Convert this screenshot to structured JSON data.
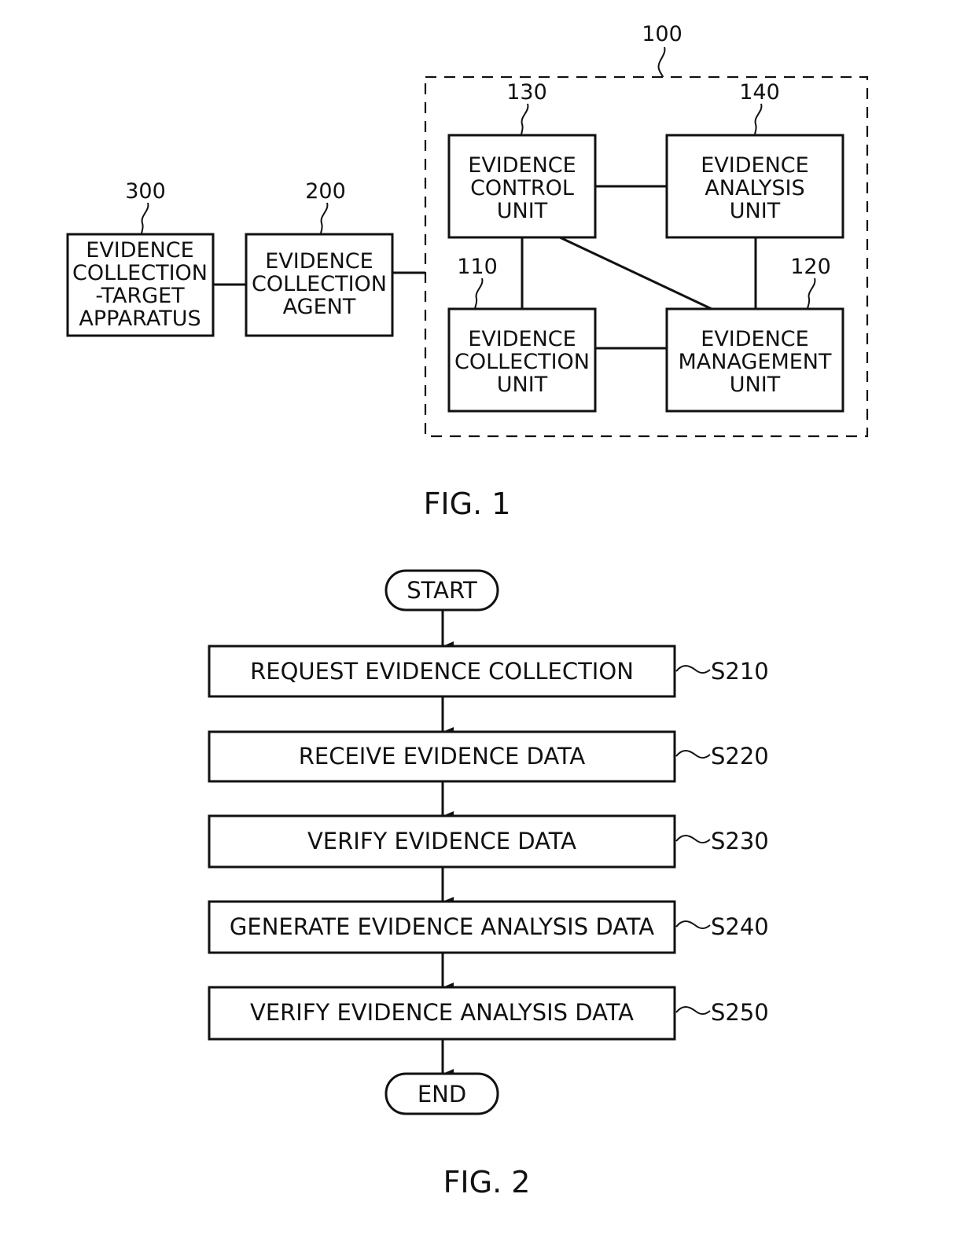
{
  "fig1": {
    "caption": "FIG. 1",
    "system_ref": "100",
    "blocks": {
      "target": {
        "ref": "300",
        "lines": [
          "EVIDENCE",
          "COLLECTION",
          "-TARGET",
          "APPARATUS"
        ]
      },
      "agent": {
        "ref": "200",
        "lines": [
          "EVIDENCE",
          "COLLECTION",
          "AGENT"
        ]
      },
      "control": {
        "ref": "130",
        "lines": [
          "EVIDENCE",
          "CONTROL",
          "UNIT"
        ]
      },
      "analysis": {
        "ref": "140",
        "lines": [
          "EVIDENCE",
          "ANALYSIS",
          "UNIT"
        ]
      },
      "collection": {
        "ref": "110",
        "lines": [
          "EVIDENCE",
          "COLLECTION",
          "UNIT"
        ]
      },
      "management": {
        "ref": "120",
        "lines": [
          "EVIDENCE",
          "MANAGEMENT",
          "UNIT"
        ]
      }
    }
  },
  "fig2": {
    "caption": "FIG. 2",
    "start": "START",
    "end": "END",
    "steps": [
      {
        "label": "REQUEST EVIDENCE COLLECTION",
        "ref": "S210"
      },
      {
        "label": "RECEIVE EVIDENCE DATA",
        "ref": "S220"
      },
      {
        "label": "VERIFY EVIDENCE DATA",
        "ref": "S230"
      },
      {
        "label": "GENERATE EVIDENCE ANALYSIS DATA",
        "ref": "S240"
      },
      {
        "label": "VERIFY EVIDENCE ANALYSIS DATA",
        "ref": "S250"
      }
    ]
  }
}
